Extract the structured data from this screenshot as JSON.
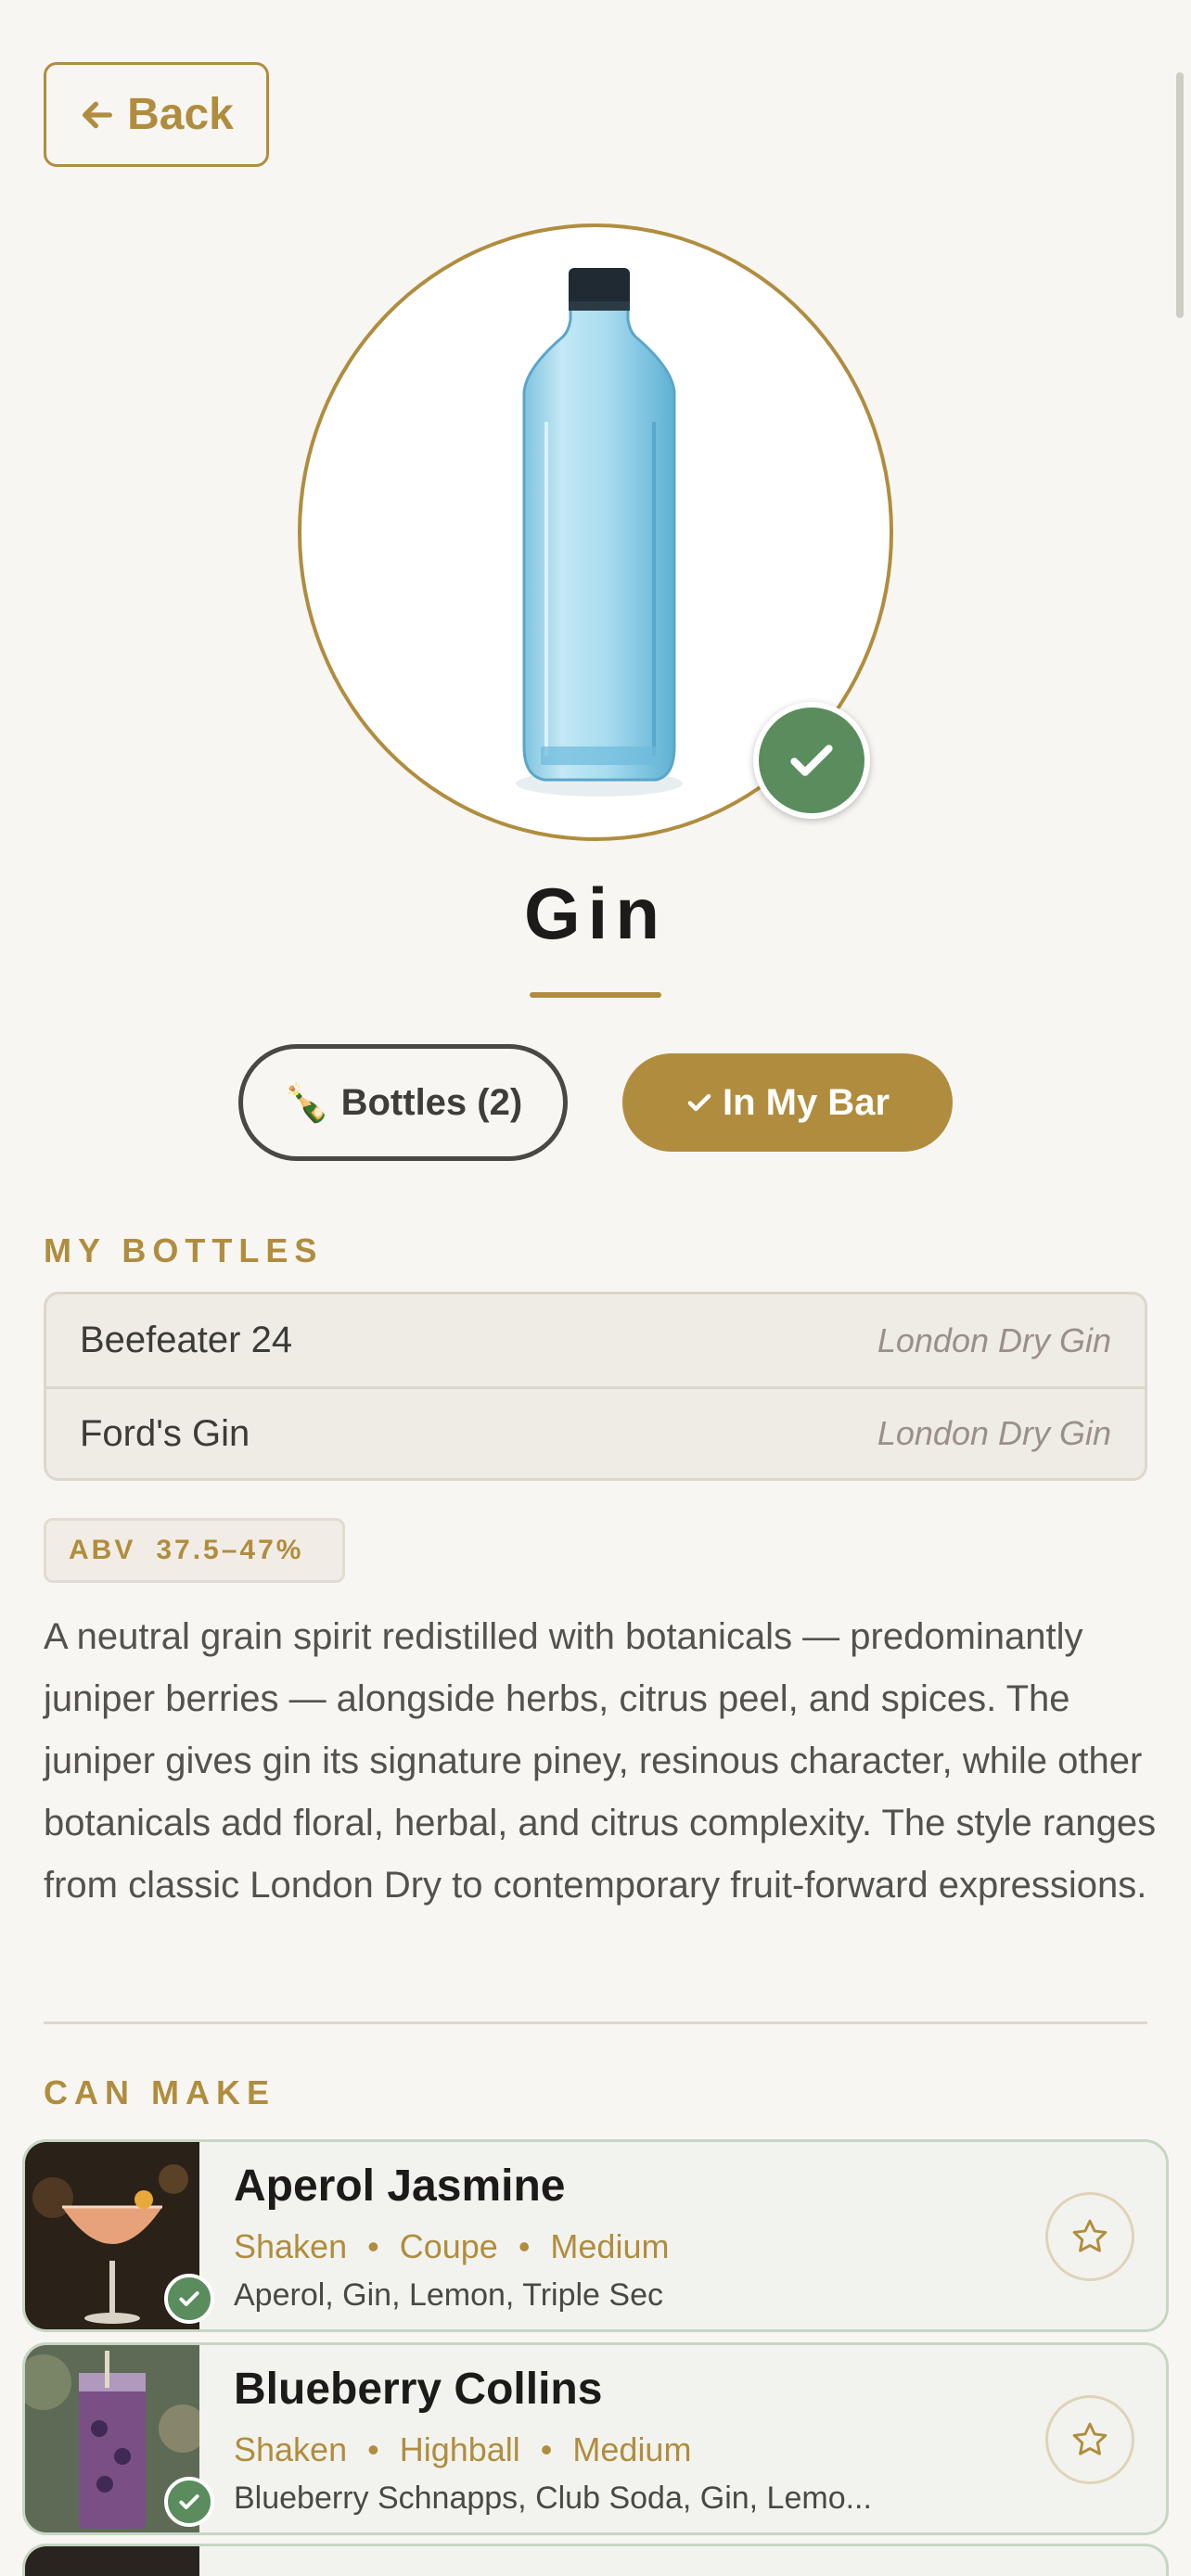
{
  "nav": {
    "back_label": "Back"
  },
  "ingredient": {
    "name": "Gin",
    "bottles_label": "Bottles (2)",
    "bottles_emoji": "🍾",
    "in_bar_label": "In My Bar",
    "in_bar": true
  },
  "my_bottles": {
    "heading": "MY BOTTLES",
    "items": [
      {
        "name": "Beefeater 24",
        "type": "London Dry Gin"
      },
      {
        "name": "Ford's Gin",
        "type": "London Dry Gin"
      }
    ]
  },
  "abv": {
    "label": "ABV",
    "value": "37.5–47%"
  },
  "description": "A neutral grain spirit redistilled with botanicals — predominantly juniper berries — alongside herbs, citrus peel, and spices. The juniper gives gin its signature piney, resinous character, while other botanicals add floral, herbal, and citrus complexity. The style ranges from classic London Dry to contemporary fruit-forward expressions.",
  "can_make": {
    "heading": "CAN MAKE",
    "cocktails": [
      {
        "name": "Aperol Jasmine",
        "method": "Shaken",
        "glass": "Coupe",
        "difficulty": "Medium",
        "ingredients": "Aperol, Gin, Lemon, Triple Sec"
      },
      {
        "name": "Blueberry Collins",
        "method": "Shaken",
        "glass": "Highball",
        "difficulty": "Medium",
        "ingredients": "Blueberry Schnapps, Club Soda, Gin, Lemo..."
      }
    ]
  },
  "colors": {
    "accent": "#b08d3e",
    "success": "#5a8c5e",
    "background": "#f8f6f2"
  }
}
